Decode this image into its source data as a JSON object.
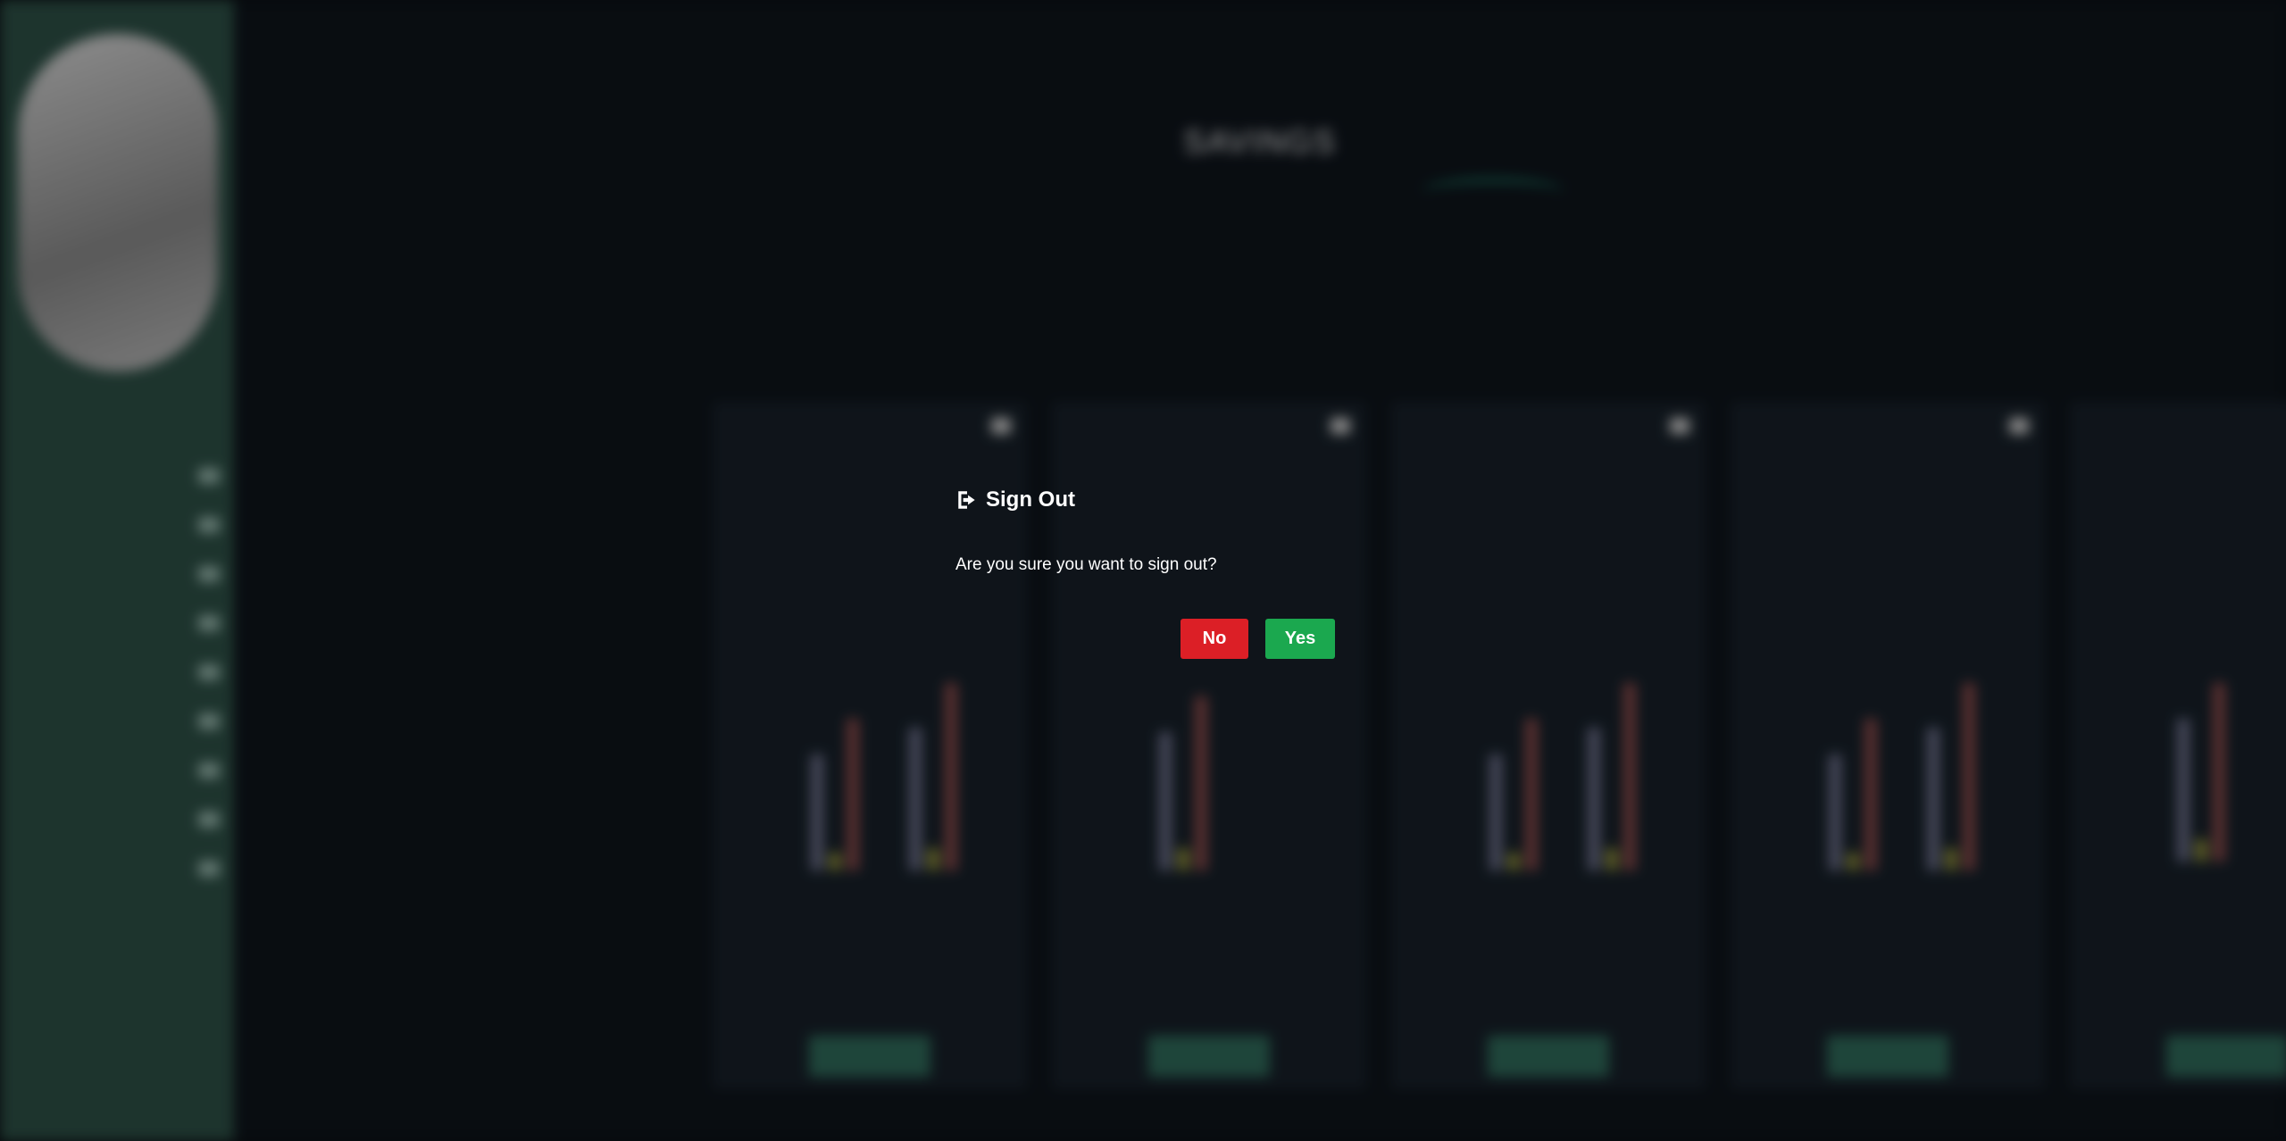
{
  "modal": {
    "title": "Sign Out",
    "message": "Are you sure you want to sign out?",
    "no_label": "No",
    "yes_label": "Yes",
    "icon": "sign-out-icon",
    "colors": {
      "no": "#dc1f26",
      "yes": "#1ba84f"
    }
  },
  "background": {
    "blurred": true,
    "page_title": "SAVINGS"
  },
  "colors": {
    "sidebar": "#2d5046",
    "main_bg": "#0e141b",
    "card_bg": "#172029",
    "accent": "#1d8f73"
  }
}
